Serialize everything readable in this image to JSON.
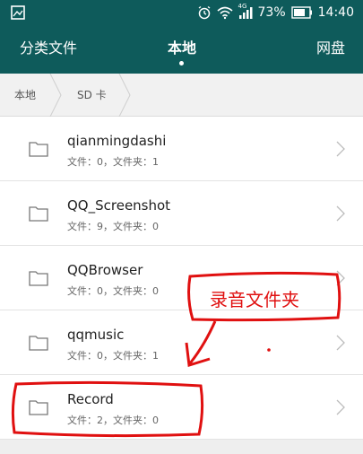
{
  "status_bar": {
    "network_tag": "4G",
    "battery_percent": "73%",
    "time": "14:40",
    "icons": [
      "image-icon",
      "alarm-icon",
      "wifi-icon",
      "signal-icon",
      "battery-icon"
    ]
  },
  "tabs": {
    "left": "分类文件",
    "center": "本地",
    "right": "网盘"
  },
  "breadcrumb": {
    "items": [
      "本地",
      "SD 卡"
    ]
  },
  "folders": [
    {
      "name": "qianmingdashi",
      "meta": "文件：0，文件夹：1"
    },
    {
      "name": "QQ_Screenshot",
      "meta": "文件：9，文件夹：0"
    },
    {
      "name": "QQBrowser",
      "meta": "文件：0，文件夹：0"
    },
    {
      "name": "qqmusic",
      "meta": "文件：0，文件夹：1"
    },
    {
      "name": "Record",
      "meta": "文件：2，文件夹：0"
    }
  ],
  "annotation": {
    "callout_text": "录音文件夹",
    "color": "#e01010"
  },
  "colors": {
    "header": "#0e5b5b",
    "background": "#eeeeee"
  }
}
